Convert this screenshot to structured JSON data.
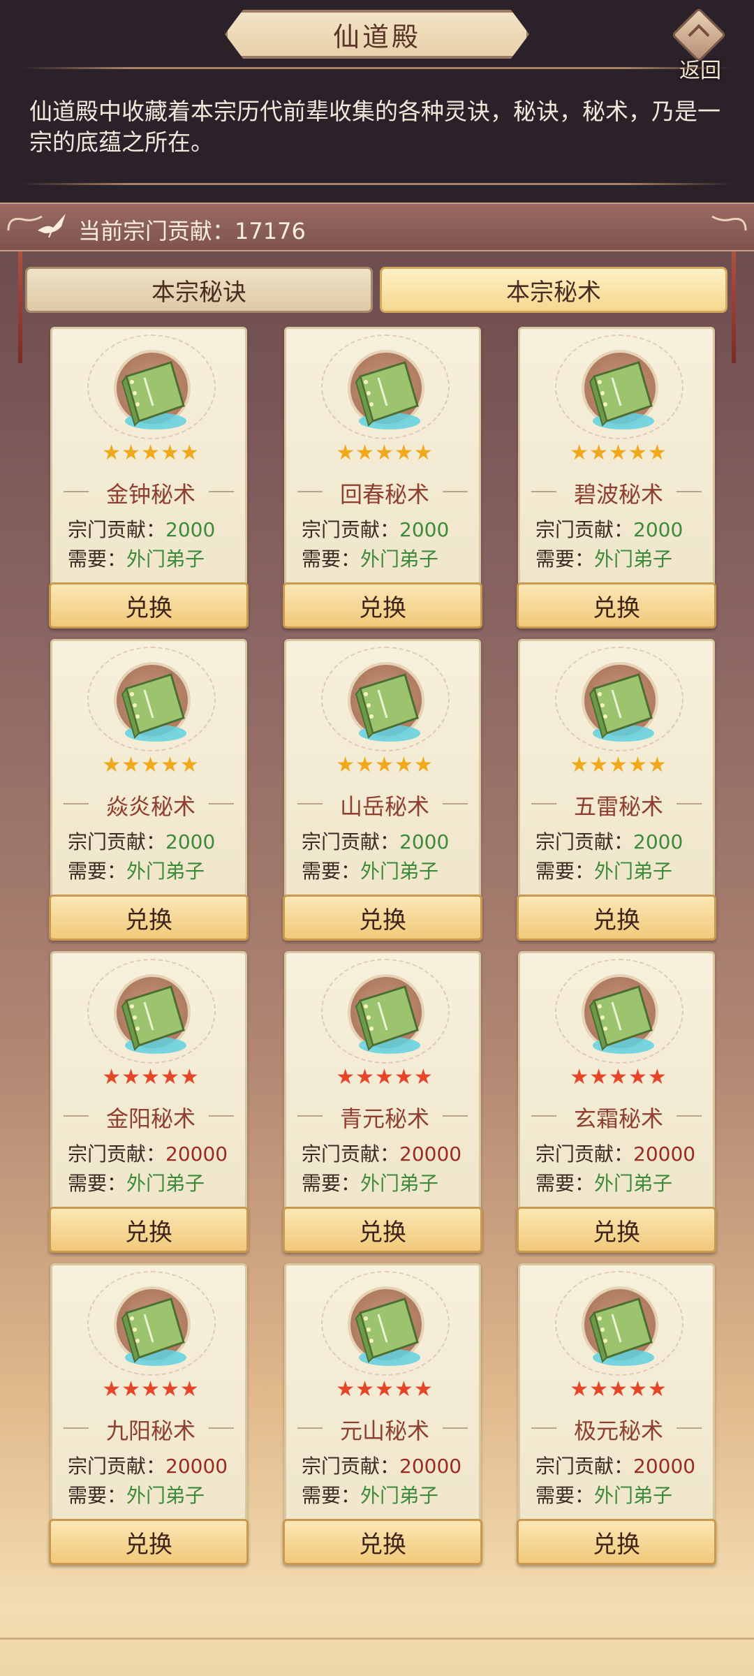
{
  "header": {
    "title": "仙道殿",
    "back_label": "返回",
    "description": "仙道殿中收藏着本宗历代前辈收集的各种灵诀，秘诀，秘术，乃是一宗的底蕴之所在。"
  },
  "contribution": {
    "text": "当前宗门贡献：17176"
  },
  "tabs": [
    {
      "label": "本宗秘诀",
      "selected": false
    },
    {
      "label": "本宗秘术",
      "selected": true
    }
  ],
  "colors": {
    "star_gold": "#f0a81c",
    "star_red": "#e5462a",
    "cost_green": "#3c8a3a",
    "cost_red": "#9b2a22"
  },
  "cards": [
    {
      "name": "金钟秘术",
      "stars": 5,
      "star_color": "gold",
      "cost_label": "宗门贡献：",
      "cost": "2000",
      "req_label": "需要：",
      "req": "外门弟子",
      "button": "兑换"
    },
    {
      "name": "回春秘术",
      "stars": 5,
      "star_color": "gold",
      "cost_label": "宗门贡献：",
      "cost": "2000",
      "req_label": "需要：",
      "req": "外门弟子",
      "button": "兑换"
    },
    {
      "name": "碧波秘术",
      "stars": 5,
      "star_color": "gold",
      "cost_label": "宗门贡献：",
      "cost": "2000",
      "req_label": "需要：",
      "req": "外门弟子",
      "button": "兑换"
    },
    {
      "name": "焱炎秘术",
      "stars": 5,
      "star_color": "gold",
      "cost_label": "宗门贡献：",
      "cost": "2000",
      "req_label": "需要：",
      "req": "外门弟子",
      "button": "兑换"
    },
    {
      "name": "山岳秘术",
      "stars": 5,
      "star_color": "gold",
      "cost_label": "宗门贡献：",
      "cost": "2000",
      "req_label": "需要：",
      "req": "外门弟子",
      "button": "兑换"
    },
    {
      "name": "五雷秘术",
      "stars": 5,
      "star_color": "gold",
      "cost_label": "宗门贡献：",
      "cost": "2000",
      "req_label": "需要：",
      "req": "外门弟子",
      "button": "兑换"
    },
    {
      "name": "金阳秘术",
      "stars": 5,
      "star_color": "red",
      "cost_label": "宗门贡献：",
      "cost": "20000",
      "req_label": "需要：",
      "req": "外门弟子",
      "button": "兑换"
    },
    {
      "name": "青元秘术",
      "stars": 5,
      "star_color": "red",
      "cost_label": "宗门贡献：",
      "cost": "20000",
      "req_label": "需要：",
      "req": "外门弟子",
      "button": "兑换"
    },
    {
      "name": "玄霜秘术",
      "stars": 5,
      "star_color": "red",
      "cost_label": "宗门贡献：",
      "cost": "20000",
      "req_label": "需要：",
      "req": "外门弟子",
      "button": "兑换"
    },
    {
      "name": "九阳秘术",
      "stars": 5,
      "star_color": "red",
      "cost_label": "宗门贡献：",
      "cost": "20000",
      "req_label": "需要：",
      "req": "外门弟子",
      "button": "兑换"
    },
    {
      "name": "元山秘术",
      "stars": 5,
      "star_color": "red",
      "cost_label": "宗门贡献：",
      "cost": "20000",
      "req_label": "需要：",
      "req": "外门弟子",
      "button": "兑换"
    },
    {
      "name": "极元秘术",
      "stars": 5,
      "star_color": "red",
      "cost_label": "宗门贡献：",
      "cost": "20000",
      "req_label": "需要：",
      "req": "外门弟子",
      "button": "兑换"
    }
  ]
}
